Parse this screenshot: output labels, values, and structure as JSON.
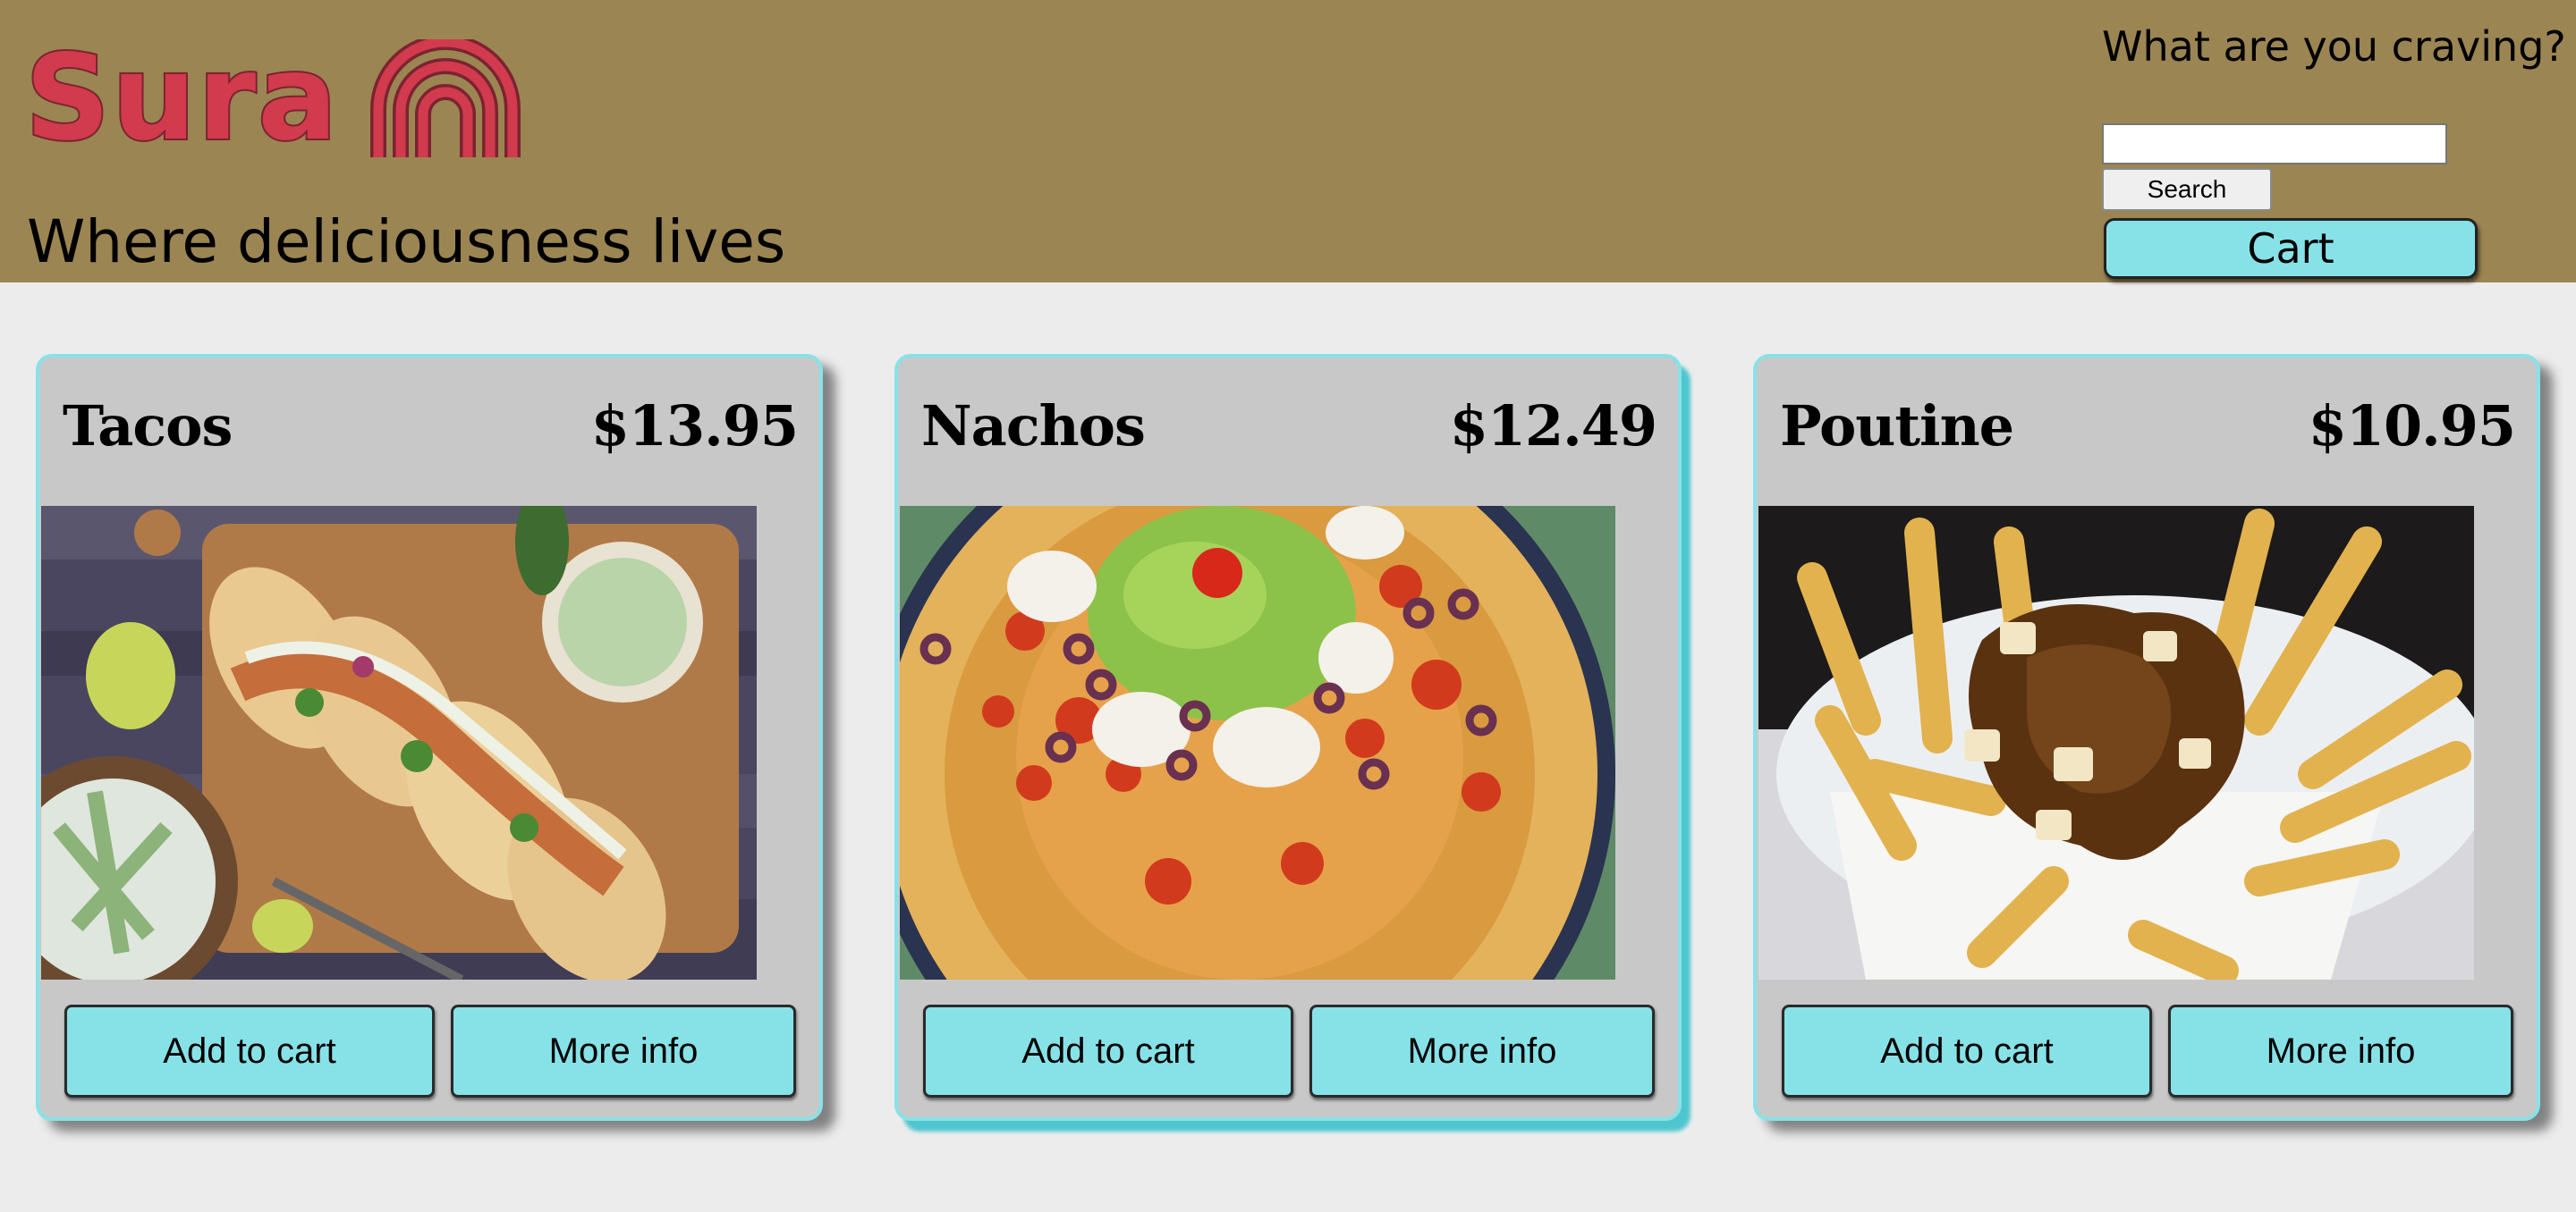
{
  "header": {
    "logo_text": "Sura",
    "tagline": "Where deliciousness lives",
    "search_prompt": "What are you craving?",
    "search_value": "",
    "search_button": "Search",
    "cart_button": "Cart"
  },
  "items": [
    {
      "name": "Tacos",
      "price": "$13.95",
      "add_label": "Add to cart",
      "info_label": "More info"
    },
    {
      "name": "Nachos",
      "price": "$12.49",
      "add_label": "Add to cart",
      "info_label": "More info"
    },
    {
      "name": "Poutine",
      "price": "$10.95",
      "add_label": "Add to cart",
      "info_label": "More info"
    }
  ],
  "colors": {
    "header_bg": "#9b8552",
    "logo_red": "#d23a4e",
    "accent_cyan": "#87e2e8",
    "card_bg": "#c8c8c8",
    "page_bg": "#ececec"
  }
}
